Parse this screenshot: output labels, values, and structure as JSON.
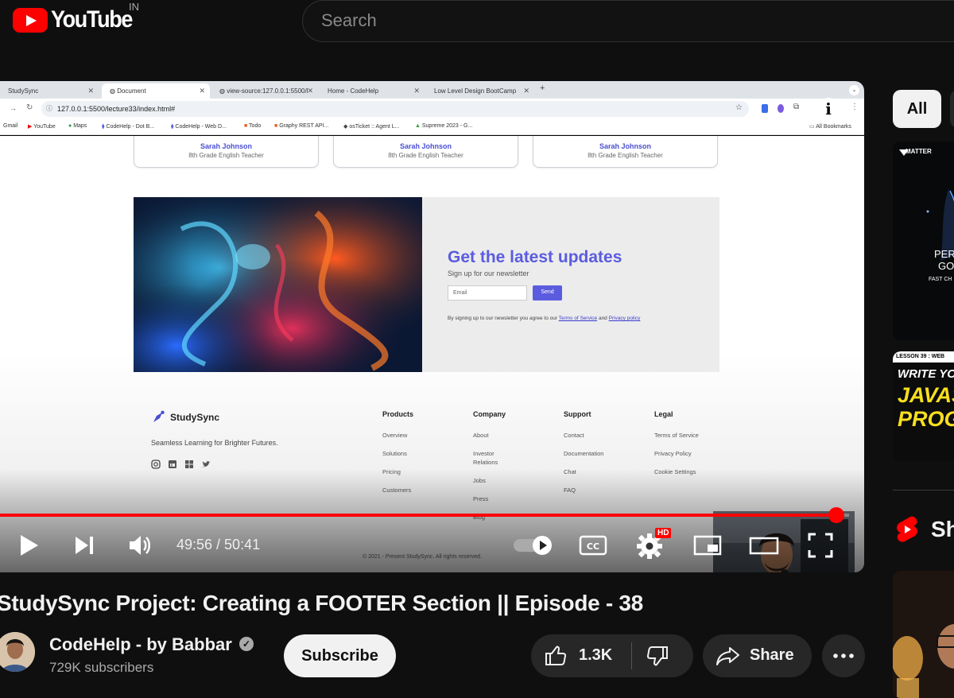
{
  "masthead": {
    "logo_text": "YouTube",
    "country_code": "IN",
    "search_placeholder": "Search"
  },
  "recorded_browser": {
    "tabs": [
      {
        "label": "StudySync"
      },
      {
        "label": "Document"
      },
      {
        "label": "view-source:127.0.0.1:5500/l"
      },
      {
        "label": "Home - CodeHelp"
      },
      {
        "label": "Low Level Design BootCamp"
      }
    ],
    "url": "127.0.0.1:5500/lecture33/index.html#",
    "bookmarks": [
      "Gmail",
      "YouTube",
      "Maps",
      "CodeHelp - Dot B...",
      "CodeHelp - Web D...",
      "Todo",
      "Graphy REST API...",
      "osTicket :: Agent L...",
      "Supreme 2023 - G...",
      "All Bookmarks"
    ]
  },
  "recorded_page": {
    "testimonials": [
      {
        "name": "Sarah Johnson",
        "role": "8th Grade English Teacher"
      },
      {
        "name": "Sarah Johnson",
        "role": "8th Grade English Teacher"
      },
      {
        "name": "Sarah Johnson",
        "role": "8th Grade English Teacher"
      }
    ],
    "newsletter": {
      "title": "Get the latest updates",
      "subtitle": "Sign up for our newsletter",
      "email_placeholder": "Email",
      "send_label": "Send",
      "legal_prefix": "By signing up to our newsletter you agree to our",
      "terms_link": "Terms of Service",
      "and_text": "and",
      "privacy_link": "Privacy policy"
    },
    "footer": {
      "brand": "StudySync",
      "tagline": "Seamless Learning for Brighter Futures.",
      "columns": [
        {
          "heading": "Products",
          "links": [
            "Overview",
            "Solutions",
            "Pricing",
            "Customers"
          ]
        },
        {
          "heading": "Company",
          "links": [
            "About",
            "Investor Relations",
            "Jobs",
            "Press",
            "Blog"
          ]
        },
        {
          "heading": "Support",
          "links": [
            "Contact",
            "Documentation",
            "Chat",
            "FAQ"
          ]
        },
        {
          "heading": "Legal",
          "links": [
            "Terms of Service",
            "Privacy Policy",
            "Cookie Settings"
          ]
        }
      ],
      "copyright": "© 2021 - Present StudySync. All rights reserved."
    }
  },
  "player": {
    "time_display": "49:56 / 50:41",
    "progress_fraction": 0.985,
    "hd_badge": "HD",
    "colors": {
      "progress": "#ff0000"
    }
  },
  "video": {
    "title": "StudySync Project: Creating a FOOTER Section || Episode - 38",
    "channel_name": "CodeHelp - by Babbar",
    "subscribers": "729K subscribers",
    "subscribe_label": "Subscribe",
    "like_count": "1.3K",
    "share_label": "Share"
  },
  "sidebar": {
    "chip_all": "All",
    "shorts_label": "Sh",
    "thumb1_text": [
      "MATTER",
      "PER",
      "GO",
      "FAST CH"
    ],
    "thumb2_text": [
      "LESSON 39 : WEB",
      "WRITE YOUR",
      "JAVAS",
      "PROGR"
    ]
  }
}
